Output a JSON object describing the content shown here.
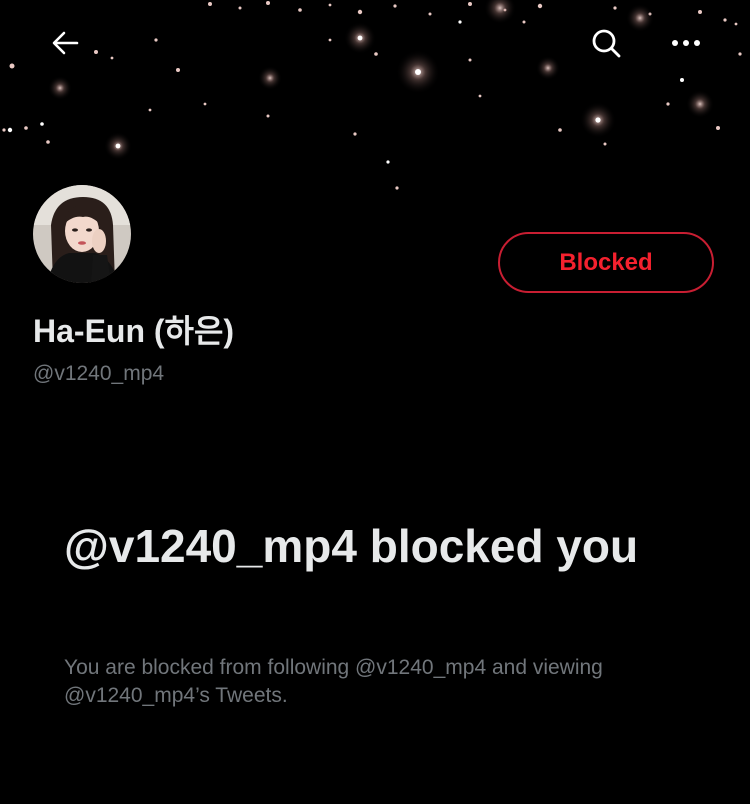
{
  "header": {
    "back_icon": "arrow-left-icon",
    "search_icon": "search-icon",
    "more_icon": "more-horizontal-icon"
  },
  "profile": {
    "display_name": "Ha-Eun (하은)",
    "handle": "@v1240_mp4",
    "blocked_button_label": "Blocked",
    "accent_color": "#f4212e"
  },
  "blocked_notice": {
    "title": "@v1240_mp4 blocked you",
    "description": "You are blocked from following @v1240_mp4 and viewing @v1240_mp4’s Tweets."
  }
}
